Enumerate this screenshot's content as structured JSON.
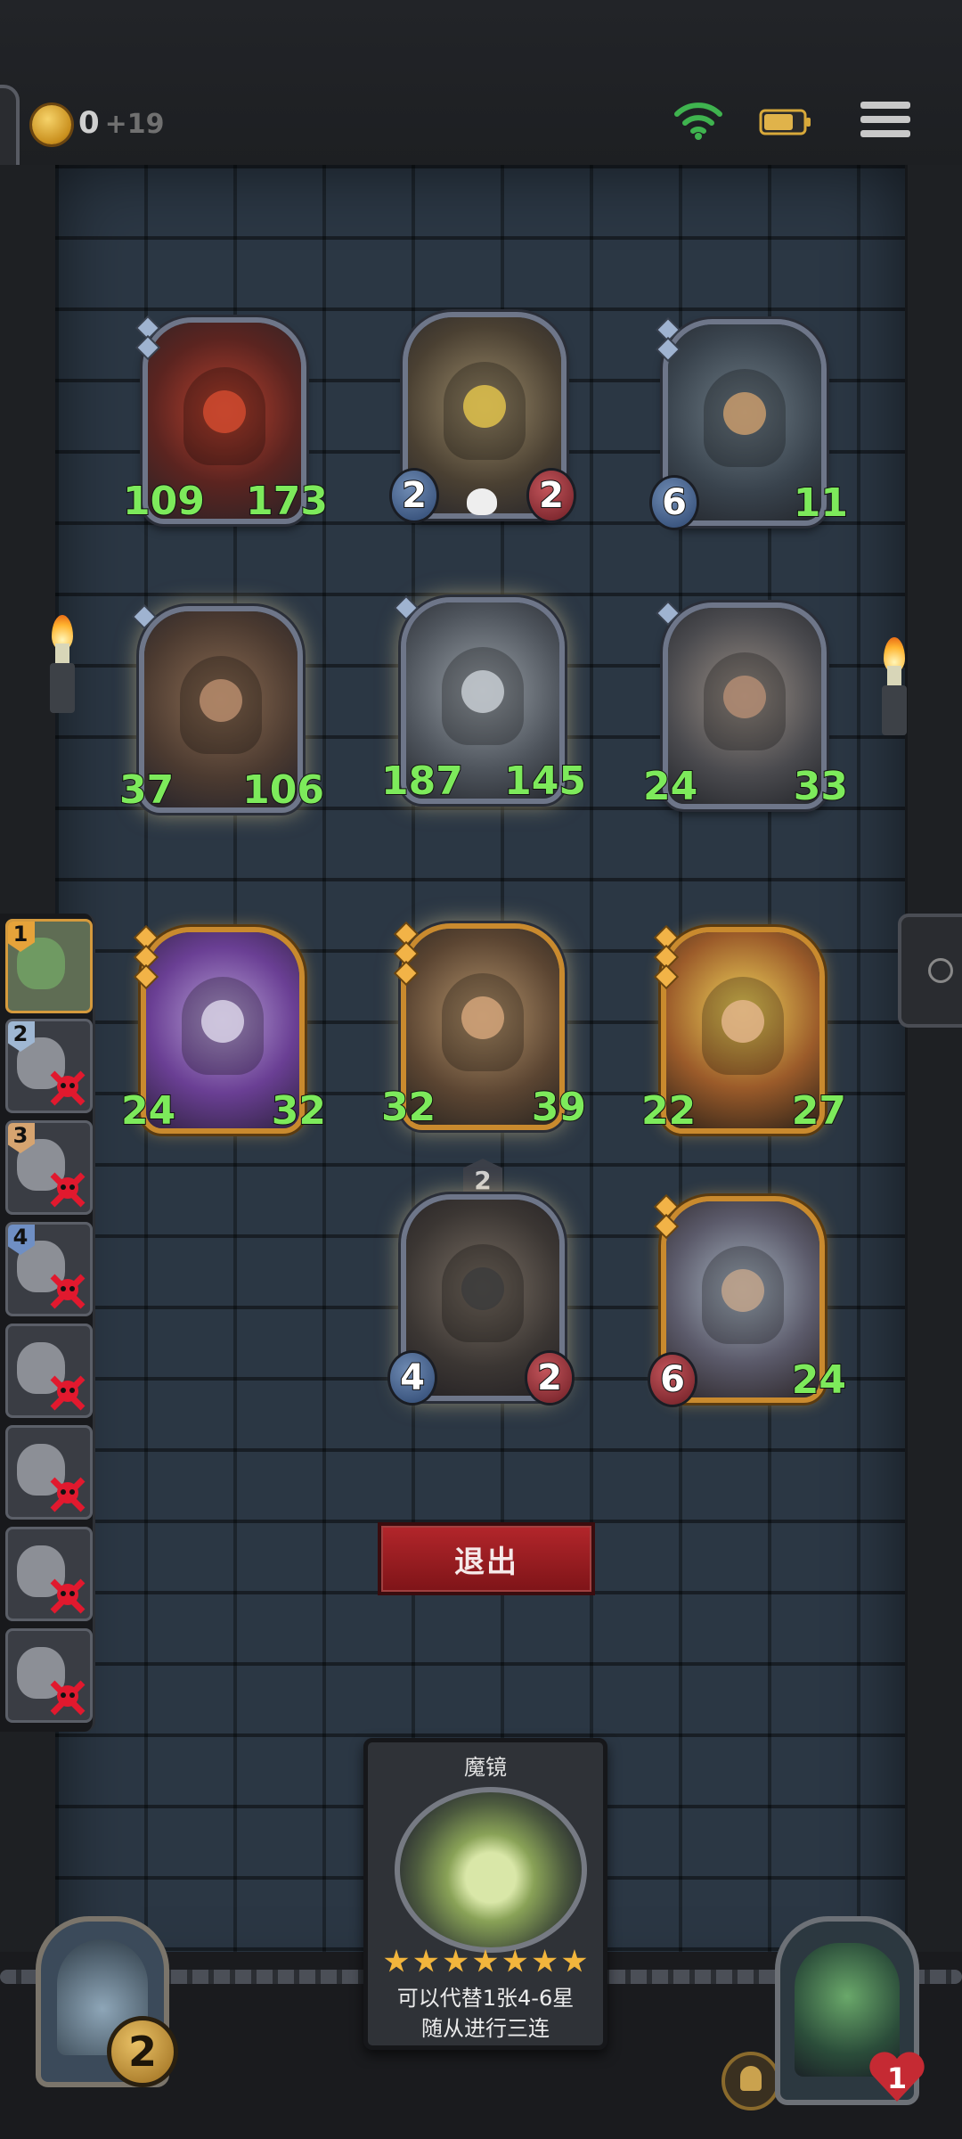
{
  "topbar": {
    "coins": "0",
    "coin_income": "+19",
    "icons": [
      "coin-icon",
      "wifi-icon",
      "battery-icon",
      "menu-icon"
    ]
  },
  "board": {
    "opponent_row1": [
      {
        "attack": "109",
        "health": "173",
        "big": true
      },
      {
        "attack": "2",
        "health": "2",
        "big": false
      },
      {
        "attack": "6",
        "health": "11",
        "big": false
      }
    ],
    "opponent_row2": [
      {
        "attack": "37",
        "health": "106",
        "big": true
      },
      {
        "attack": "187",
        "health": "145",
        "big": true
      },
      {
        "attack": "24",
        "health": "33",
        "big": true
      }
    ],
    "player_row1": [
      {
        "attack": "24",
        "health": "32",
        "big": true
      },
      {
        "attack": "32",
        "health": "39",
        "big": true
      },
      {
        "attack": "22",
        "health": "27",
        "big": true
      }
    ],
    "player_row2": [
      {
        "attack": "4",
        "health": "2",
        "big": false,
        "badge": "2"
      },
      {
        "attack": "6",
        "health": "24",
        "big": true
      }
    ]
  },
  "roster": {
    "ranks": [
      "1",
      "2",
      "3",
      "4"
    ],
    "rank_colors": [
      "#e6a33a",
      "#9fb7d3",
      "#d6a470",
      "#6f8fc4"
    ]
  },
  "exit_label": "退出",
  "spell_card": {
    "title": "魔镜",
    "stars": 7,
    "desc_line1": "可以代替1张4-6星",
    "desc_line2": "随从进行三连"
  },
  "shop": {
    "tier": "2"
  },
  "hero": {
    "health": "1"
  },
  "colors": {
    "accent_gold": "#c98a2e",
    "stat_green": "#7dea5b",
    "exit_red": "#b3262b",
    "wall": "#2b3744"
  }
}
